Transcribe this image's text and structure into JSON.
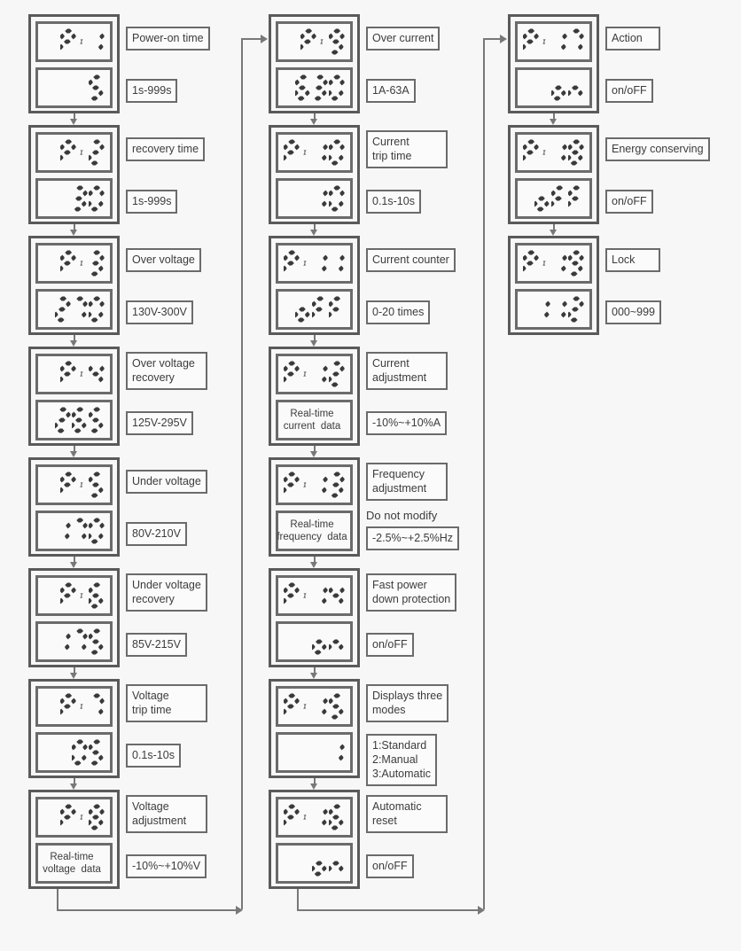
{
  "diagram": {
    "title": "Digital protector parameter setting menu flow",
    "colors": {
      "background": "#f7f7f7",
      "box_border": "#5a5a5a",
      "panel_border": "#6b6b6b",
      "label_border": "#6b6b6b",
      "connector": "#787878",
      "segment_on": "#3a3a3a"
    },
    "columns": [
      {
        "name": "column-1",
        "items": [
          {
            "code": "P-1",
            "code_disp": "P-1",
            "value": "5",
            "value_kind": "segment",
            "label": "Power-on time",
            "range": "1s-999s"
          },
          {
            "code": "P-2",
            "code_disp": "P-2",
            "value": "30",
            "value_kind": "segment",
            "label": "recovery time",
            "range": "1s-999s"
          },
          {
            "code": "P-3",
            "code_disp": "P-3",
            "value": "270",
            "value_kind": "segment",
            "label": "Over voltage",
            "range": "130V-300V"
          },
          {
            "code": "P-4",
            "code_disp": "P-4",
            "value": "265",
            "value_kind": "segment",
            "label": "Over voltage\nrecovery",
            "range": "125V-295V"
          },
          {
            "code": "P-5",
            "code_disp": "P-5",
            "value": "170",
            "value_kind": "segment",
            "label": "Under voltage",
            "range": "80V-210V"
          },
          {
            "code": "P-6",
            "code_disp": "P-6",
            "value": "175",
            "value_kind": "segment",
            "label": "Under voltage\nrecovery",
            "range": "85V-215V"
          },
          {
            "code": "P-7",
            "code_disp": "P-7",
            "value": "05",
            "value_kind": "segment",
            "label": "Voltage\ntrip time",
            "range": "0.1s-10s"
          },
          {
            "code": "P-8",
            "code_disp": "P-8",
            "value": "Real-time\nvoltage  data",
            "value_kind": "text",
            "label": "Voltage\nadjustment",
            "range": "-10%~+10%V"
          }
        ]
      },
      {
        "name": "column-2",
        "items": [
          {
            "code": "P-9",
            "code_disp": "P-9",
            "value": "630",
            "value_kind": "segment",
            "label": "Over current",
            "range": "1A-63A"
          },
          {
            "code": "P-10",
            "code_disp": "P-10",
            "value": "10",
            "value_kind": "segment",
            "label": "Current\ntrip time",
            "range": "0.1s-10s"
          },
          {
            "code": "P-11",
            "code_disp": "P-11",
            "value": "oFF",
            "value_kind": "segment",
            "label": "Current counter",
            "range": "0-20 times"
          },
          {
            "code": "P-12",
            "code_disp": "P-12",
            "value": "Real-time\ncurrent  data",
            "value_kind": "text",
            "label": "Current\nadjustment",
            "range": "-10%~+10%A"
          },
          {
            "code": "P-13",
            "code_disp": "P-13",
            "value": "Real-time\nfrequency  data",
            "value_kind": "text",
            "label": "Frequency\nadjustment",
            "note": "Do not modify",
            "range": "-2.5%~+2.5%Hz"
          },
          {
            "code": "P-14",
            "code_disp": "P-14",
            "value": "on",
            "value_kind": "segment",
            "label": "Fast power\ndown protection",
            "range": "on/oFF"
          },
          {
            "code": "P-15",
            "code_disp": "P-15",
            "value": "1",
            "value_kind": "segment",
            "label": "Displays three\nmodes",
            "range": "1:Standard\n2:Manual\n3:Automatic"
          },
          {
            "code": "P-16",
            "code_disp": "P-16",
            "value": "on",
            "value_kind": "segment",
            "label": "Automatic\nreset",
            "range": "on/oFF"
          }
        ]
      },
      {
        "name": "column-3",
        "items": [
          {
            "code": "P-17",
            "code_disp": "P-17",
            "value": "on",
            "value_kind": "segment",
            "label": "Action",
            "range": "on/oFF"
          },
          {
            "code": "P-18",
            "code_disp": "P-18",
            "value": "oFF",
            "value_kind": "segment",
            "label": "Energy conserving",
            "range": "on/oFF"
          },
          {
            "code": "P-19",
            "code_disp": "P-19",
            "value": "112",
            "value_kind": "segment",
            "label": "Lock",
            "range": "000~999"
          }
        ]
      }
    ]
  }
}
